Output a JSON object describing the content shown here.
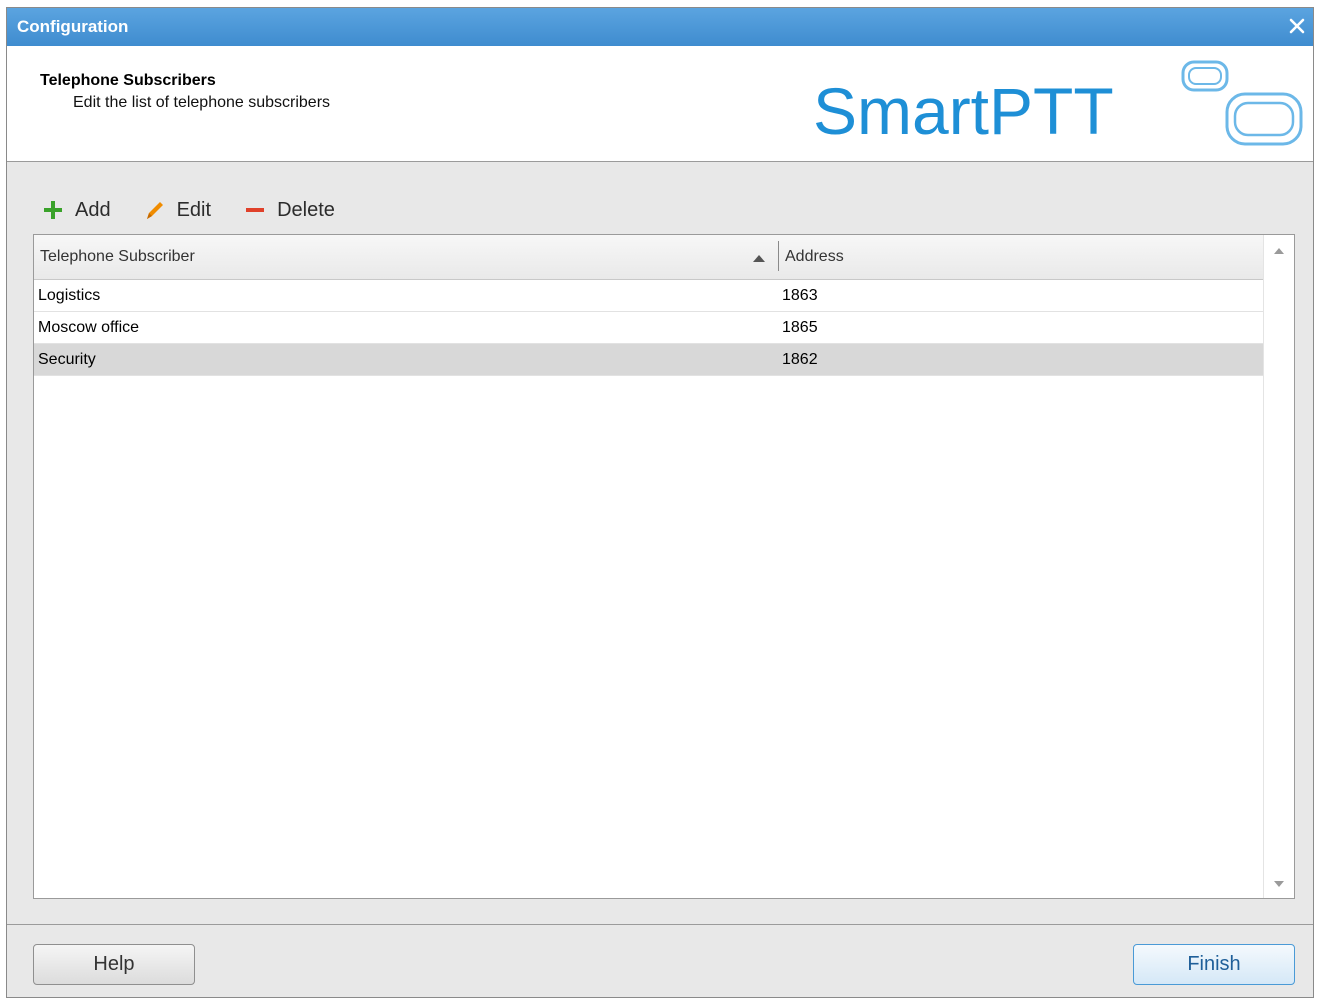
{
  "window": {
    "title": "Configuration"
  },
  "header": {
    "title": "Telephone Subscribers",
    "subtitle": "Edit the list of telephone subscribers",
    "logo_text": "SmartPTT"
  },
  "toolbar": {
    "add_label": "Add",
    "edit_label": "Edit",
    "delete_label": "Delete"
  },
  "grid": {
    "columns": [
      "Telephone Subscriber",
      "Address"
    ],
    "sort": {
      "column": "Telephone Subscriber",
      "direction": "ascending"
    },
    "rows": [
      {
        "name": "Logistics",
        "address": "1863",
        "selected": false
      },
      {
        "name": "Moscow office",
        "address": "1865",
        "selected": false
      },
      {
        "name": "Security",
        "address": "1862",
        "selected": true
      }
    ]
  },
  "footer": {
    "help_label": "Help",
    "finish_label": "Finish"
  },
  "colors": {
    "titlebar": "#4a96d8",
    "logo_blue": "#1e8fd6",
    "add_icon": "#3aa22a",
    "edit_icon": "#f08c00",
    "delete_icon": "#e0412a",
    "selected_row": "#d8d8d8"
  },
  "icons": [
    "close-icon",
    "add-icon",
    "edit-pencil-icon",
    "delete-minus-icon",
    "sort-ascending-icon",
    "scroll-up-icon",
    "scroll-down-icon"
  ]
}
